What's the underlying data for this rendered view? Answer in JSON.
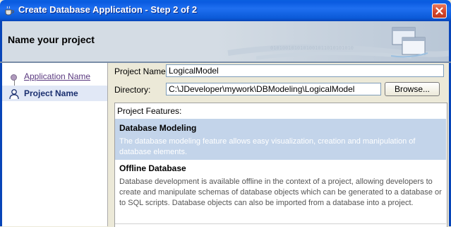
{
  "window": {
    "title": "Create Database Application - Step 2 of 2",
    "icon": "coffee-cup-icon",
    "close_icon": "close-icon"
  },
  "header": {
    "title": "Name your project",
    "decoration_text": "0101001010101001011010101010"
  },
  "nav": {
    "items": [
      {
        "label": "Application Name",
        "icon": "step-dot-icon",
        "state": "visited"
      },
      {
        "label": "Project Name",
        "icon": "person-icon",
        "state": "current"
      }
    ]
  },
  "form": {
    "project_name_label": "Project Name:",
    "project_name_value": "LogicalModel",
    "directory_label": "Directory:",
    "directory_value": "C:\\JDeveloper\\mywork\\DBModeling\\LogicalModel",
    "browse_label": "Browse..."
  },
  "features": {
    "title": "Project Features:",
    "items": [
      {
        "title": "Database Modeling",
        "description": "The database modeling feature allows easy visualization, creation and manipulation of database elements.",
        "selected": true
      },
      {
        "title": "Offline Database",
        "description": "Database development is available offline in the context of a project, allowing developers to create and manipulate schemas of database objects which can be generated to a database or to SQL scripts. Database objects can also be imported from a database into a project.",
        "selected": false
      }
    ]
  },
  "colors": {
    "titlebar": "#0a5fe0",
    "selection": "#c3d4ea",
    "nav_current_bg": "#e1e8f6"
  }
}
